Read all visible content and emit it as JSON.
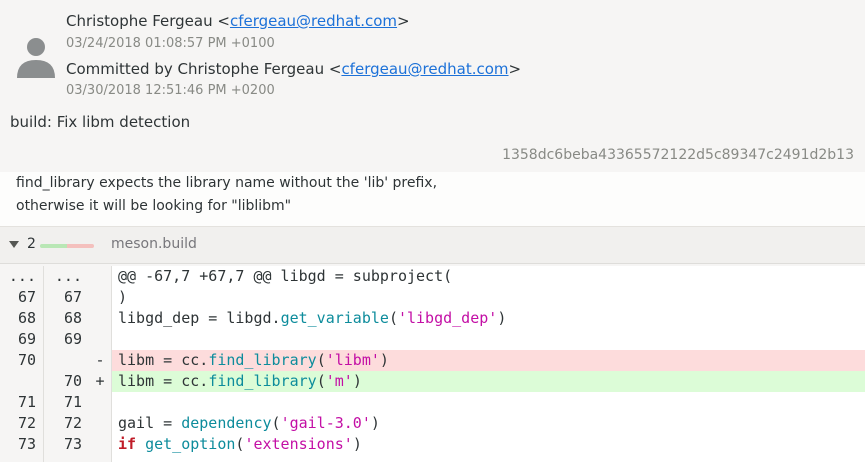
{
  "commit": {
    "author_name": "Christophe Fergeau",
    "author_email": "cfergeau@redhat.com",
    "author_date": "03/24/2018 01:08:57 PM +0100",
    "committed_by_prefix": "Committed by Christophe Fergeau",
    "committer_email": "cfergeau@redhat.com",
    "commit_date": "03/30/2018 12:51:46 PM +0200",
    "subject": "build: Fix libm detection",
    "sha": "1358dc6beba43365572122d5c89347c2491d2b13",
    "body_line1": "find_library expects the library name without the 'lib' prefix,",
    "body_line2": "otherwise it will be looking for \"liblibm\""
  },
  "file": {
    "change_count": "2",
    "name": "meson.build",
    "added_fraction": 0.5,
    "removed_fraction": 0.5
  },
  "diff_rows": [
    {
      "old": "...",
      "new": "...",
      "mark": "",
      "type": "hunk",
      "tokens": [
        [
          "@@ -67,7 +67,7 @@ libgd = subproject(",
          ""
        ]
      ]
    },
    {
      "old": "67",
      "new": "67",
      "mark": "",
      "type": "ctx",
      "tokens": [
        [
          ")",
          ""
        ]
      ]
    },
    {
      "old": "68",
      "new": "68",
      "mark": "",
      "type": "ctx",
      "tokens": [
        [
          "libgd_dep = libgd.",
          ""
        ],
        [
          "get_variable",
          "fn"
        ],
        [
          "(",
          ""
        ],
        [
          "'libgd_dep'",
          "str"
        ],
        [
          ")",
          ""
        ]
      ]
    },
    {
      "old": "69",
      "new": "69",
      "mark": "",
      "type": "ctx",
      "tokens": [
        [
          "",
          ""
        ]
      ]
    },
    {
      "old": "70",
      "new": "",
      "mark": "-",
      "type": "del",
      "tokens": [
        [
          "libm = cc.",
          ""
        ],
        [
          "find_library",
          "fn"
        ],
        [
          "(",
          ""
        ],
        [
          "'libm'",
          "str"
        ],
        [
          ")",
          ""
        ]
      ]
    },
    {
      "old": "",
      "new": "70",
      "mark": "+",
      "type": "add",
      "tokens": [
        [
          "libm = cc.",
          ""
        ],
        [
          "find_library",
          "fn"
        ],
        [
          "(",
          ""
        ],
        [
          "'m'",
          "str"
        ],
        [
          ")",
          ""
        ]
      ]
    },
    {
      "old": "71",
      "new": "71",
      "mark": "",
      "type": "ctx",
      "tokens": [
        [
          "",
          ""
        ]
      ]
    },
    {
      "old": "72",
      "new": "72",
      "mark": "",
      "type": "ctx",
      "tokens": [
        [
          "gail = ",
          ""
        ],
        [
          "dependency",
          "fn"
        ],
        [
          "(",
          ""
        ],
        [
          "'gail-3.0'",
          "str"
        ],
        [
          ")",
          ""
        ]
      ]
    },
    {
      "old": "73",
      "new": "73",
      "mark": "",
      "type": "ctx",
      "tokens": [
        [
          "if",
          "kw"
        ],
        [
          " ",
          ""
        ],
        [
          "get_option",
          "fn"
        ],
        [
          "(",
          ""
        ],
        [
          "'extensions'",
          "str"
        ],
        [
          ")",
          ""
        ]
      ]
    }
  ],
  "colors": {
    "link": "#1c71d8",
    "deleted_bg": "#fddcdc",
    "added_bg": "#dcfcd7",
    "function": "#0d8c9c",
    "string": "#c30fa5",
    "keyword": "#c01c28"
  }
}
